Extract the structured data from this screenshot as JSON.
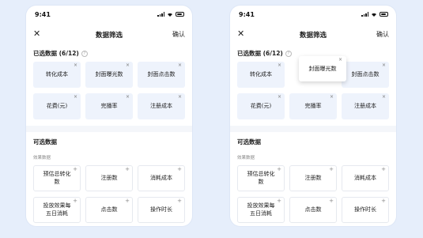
{
  "status": {
    "time": "9:41"
  },
  "nav": {
    "close_icon": "✕",
    "title": "数据筛选",
    "confirm_label": "确认"
  },
  "selected": {
    "title": "已选数据 (6/12)",
    "help_icon": "?",
    "remove_icon": "×",
    "items": [
      "转化成本",
      "封面曝光数",
      "封面点击数",
      "花费(元)",
      "完播率",
      "注册成本"
    ]
  },
  "available": {
    "title": "可选数据",
    "group_label": "效果数据",
    "add_icon": "+",
    "items": [
      "预估总转化\n数",
      "注册数",
      "消耗成本",
      "投放效果每\n五日消耗",
      "点击数",
      "操作时长"
    ]
  },
  "dragging": {
    "label": "封面曝光数"
  }
}
